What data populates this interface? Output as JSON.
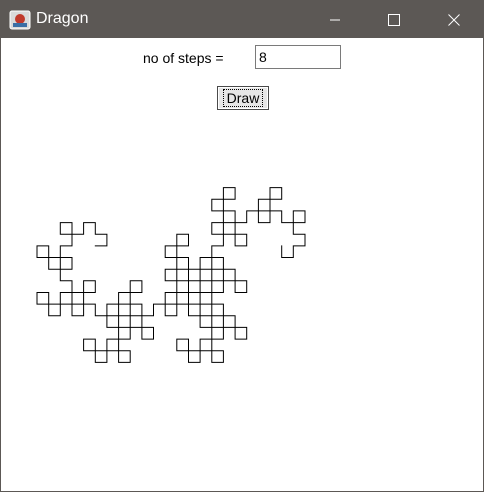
{
  "window": {
    "title": "Dragon",
    "controls": [
      "minimize",
      "maximize",
      "close"
    ]
  },
  "form": {
    "steps_label": "no of steps =",
    "steps_value": "8",
    "draw_label": "Draw"
  },
  "drawing": {
    "type": "dragon-curve",
    "steps": 8,
    "stroke_color": "#000000"
  },
  "colors": {
    "titlebar": "#5c5855",
    "title_text": "#ffffff",
    "background": "#ffffff"
  }
}
